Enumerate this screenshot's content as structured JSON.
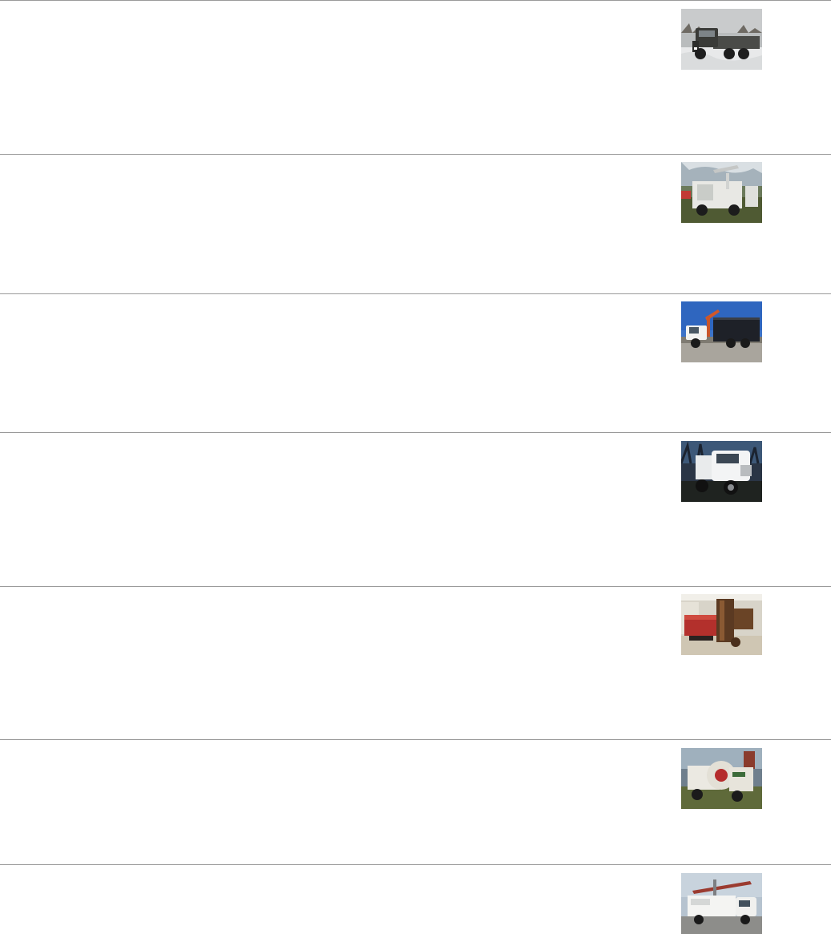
{
  "listings": [
    {
      "photo": "dump-truck-winter-photo"
    },
    {
      "photo": "service-truck-crane-photo"
    },
    {
      "photo": "flatbed-crane-truck-photo"
    },
    {
      "photo": "white-semi-tractor-photo"
    },
    {
      "photo": "red-directional-drill-photo"
    },
    {
      "photo": "vacuum-excavator-truck-photo"
    },
    {
      "photo": "utility-bucket-truck-photo"
    }
  ]
}
